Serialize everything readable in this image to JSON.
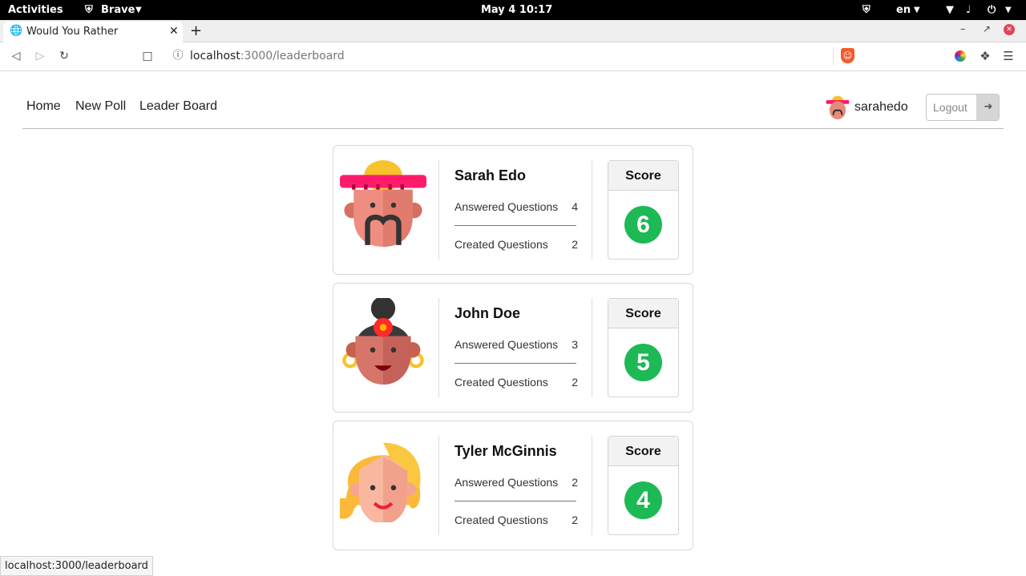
{
  "system": {
    "activities": "Activities",
    "browser": "Brave",
    "datetime": "May 4  10:17",
    "lang": "en"
  },
  "browser": {
    "tab_title": "Would You Rather",
    "url_host": "localhost",
    "url_rest": ":3000/leaderboard"
  },
  "nav": {
    "home": "Home",
    "new_poll": "New Poll",
    "leader_board": "Leader Board",
    "username": "sarahedo",
    "logout": "Logout"
  },
  "labels": {
    "answered": "Answered Questions",
    "created": "Created Questions",
    "score": "Score"
  },
  "users": [
    {
      "name": "Sarah Edo",
      "answered": "4",
      "created": "2",
      "score": "6"
    },
    {
      "name": "John Doe",
      "answered": "3",
      "created": "2",
      "score": "5"
    },
    {
      "name": "Tyler McGinnis",
      "answered": "2",
      "created": "2",
      "score": "4"
    }
  ],
  "status_url": "localhost:3000/leaderboard"
}
